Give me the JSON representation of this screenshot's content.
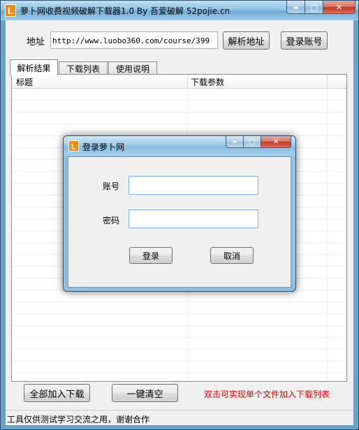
{
  "window": {
    "title": "萝卜网收费视频破解下载器1.0 By 吾爱破解 52pojie.cn",
    "logo_letter": "L",
    "controls": {
      "minimize": "▬",
      "maximize": "□",
      "close": "✕"
    }
  },
  "address": {
    "label": "地址",
    "value": "http://www.luobo360.com/course/399",
    "parse_button": "解析地址",
    "login_button": "登录账号"
  },
  "tabs": [
    {
      "label": "解析结果",
      "active": true
    },
    {
      "label": "下载列表",
      "active": false
    },
    {
      "label": "使用说明",
      "active": false
    }
  ],
  "table": {
    "columns": [
      "标题",
      "下载参数"
    ],
    "rows": []
  },
  "bottom": {
    "add_all_button": "全部加入下载",
    "clear_button": "一键清空",
    "hint": "双击可实现单个文件加入下载列表"
  },
  "status": {
    "text": "工具仅供测试学习交流之用，谢谢合作"
  },
  "dialog": {
    "title": "登录萝卜网",
    "logo_letter": "L",
    "account_label": "账号",
    "account_value": "",
    "password_label": "密码",
    "password_value": "",
    "login_button": "登录",
    "cancel_button": "取消",
    "controls": {
      "minimize": "▬",
      "maximize": "□",
      "close": "✕"
    }
  },
  "colors": {
    "hint": "#e00000",
    "logo": "#f08a10",
    "close_button": "#c0392b"
  }
}
